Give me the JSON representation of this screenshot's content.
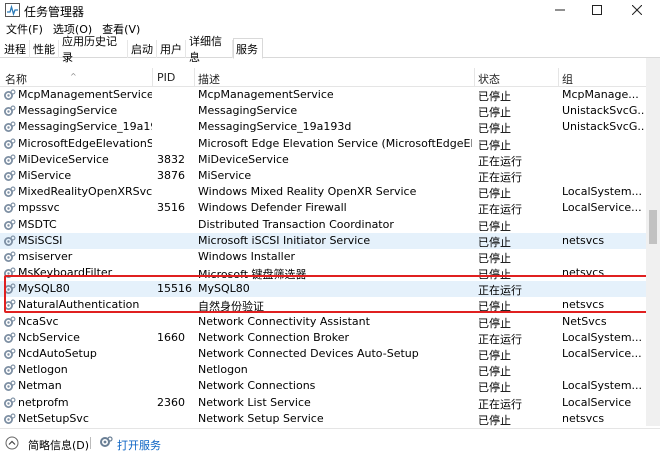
{
  "window": {
    "title": "任务管理器"
  },
  "menu": [
    "文件(F)",
    "选项(O)",
    "查看(V)"
  ],
  "tabs": [
    "进程",
    "性能",
    "应用历史记录",
    "启动",
    "用户",
    "详细信息",
    "服务"
  ],
  "active_tab": "服务",
  "columns": {
    "name": "名称",
    "pid": "PID",
    "desc": "描述",
    "status": "状态",
    "group": "组"
  },
  "rows": [
    {
      "name": "McpManagementService",
      "pid": "",
      "desc": "McpManagementService",
      "status": "已停止",
      "group": "McpManage..."
    },
    {
      "name": "MessagingService",
      "pid": "",
      "desc": "MessagingService",
      "status": "已停止",
      "group": "UnistackSvcG..."
    },
    {
      "name": "MessagingService_19a19...",
      "pid": "",
      "desc": "MessagingService_19a193d",
      "status": "已停止",
      "group": "UnistackSvcG..."
    },
    {
      "name": "MicrosoftEdgeElevationS...",
      "pid": "",
      "desc": "Microsoft Edge Elevation Service (MicrosoftEdgeElev...",
      "status": "已停止",
      "group": ""
    },
    {
      "name": "MiDeviceService",
      "pid": "3832",
      "desc": "MiDeviceService",
      "status": "正在运行",
      "group": ""
    },
    {
      "name": "MiService",
      "pid": "3876",
      "desc": "MiService",
      "status": "正在运行",
      "group": ""
    },
    {
      "name": "MixedRealityOpenXRSvc",
      "pid": "",
      "desc": "Windows Mixed Reality OpenXR Service",
      "status": "已停止",
      "group": "LocalSystem..."
    },
    {
      "name": "mpssvc",
      "pid": "3516",
      "desc": "Windows Defender Firewall",
      "status": "正在运行",
      "group": "LocalService..."
    },
    {
      "name": "MSDTC",
      "pid": "",
      "desc": "Distributed Transaction Coordinator",
      "status": "已停止",
      "group": ""
    },
    {
      "name": "MSiSCSI",
      "pid": "",
      "desc": "Microsoft iSCSI Initiator Service",
      "status": "已停止",
      "group": "netsvcs"
    },
    {
      "name": "msiserver",
      "pid": "",
      "desc": "Windows Installer",
      "status": "已停止",
      "group": ""
    },
    {
      "name": "MsKeyboardFilter",
      "pid": "",
      "desc": "Microsoft 键盘筛选器",
      "status": "已停止",
      "group": "netsvcs"
    },
    {
      "name": "MySQL80",
      "pid": "15516",
      "desc": "MySQL80",
      "status": "正在运行",
      "group": ""
    },
    {
      "name": "NaturalAuthentication",
      "pid": "",
      "desc": "自然身份验证",
      "status": "已停止",
      "group": "netsvcs"
    },
    {
      "name": "NcaSvc",
      "pid": "",
      "desc": "Network Connectivity Assistant",
      "status": "已停止",
      "group": "NetSvcs"
    },
    {
      "name": "NcbService",
      "pid": "1660",
      "desc": "Network Connection Broker",
      "status": "正在运行",
      "group": "LocalSystem..."
    },
    {
      "name": "NcdAutoSetup",
      "pid": "",
      "desc": "Network Connected Devices Auto-Setup",
      "status": "已停止",
      "group": "LocalService..."
    },
    {
      "name": "Netlogon",
      "pid": "",
      "desc": "Netlogon",
      "status": "已停止",
      "group": ""
    },
    {
      "name": "Netman",
      "pid": "",
      "desc": "Network Connections",
      "status": "已停止",
      "group": "LocalSystem..."
    },
    {
      "name": "netprofm",
      "pid": "2360",
      "desc": "Network List Service",
      "status": "正在运行",
      "group": "LocalService"
    },
    {
      "name": "NetSetupSvc",
      "pid": "",
      "desc": "Network Setup Service",
      "status": "已停止",
      "group": "netsvcs"
    }
  ],
  "highlighted_rows": [
    9,
    12
  ],
  "statusbar": {
    "brief": "简略信息(D)",
    "open_services": "打开服务"
  },
  "colors": {
    "highlight_box": "#e02020",
    "selected_row": "#e5f1fb",
    "link": "#0b63c4"
  }
}
